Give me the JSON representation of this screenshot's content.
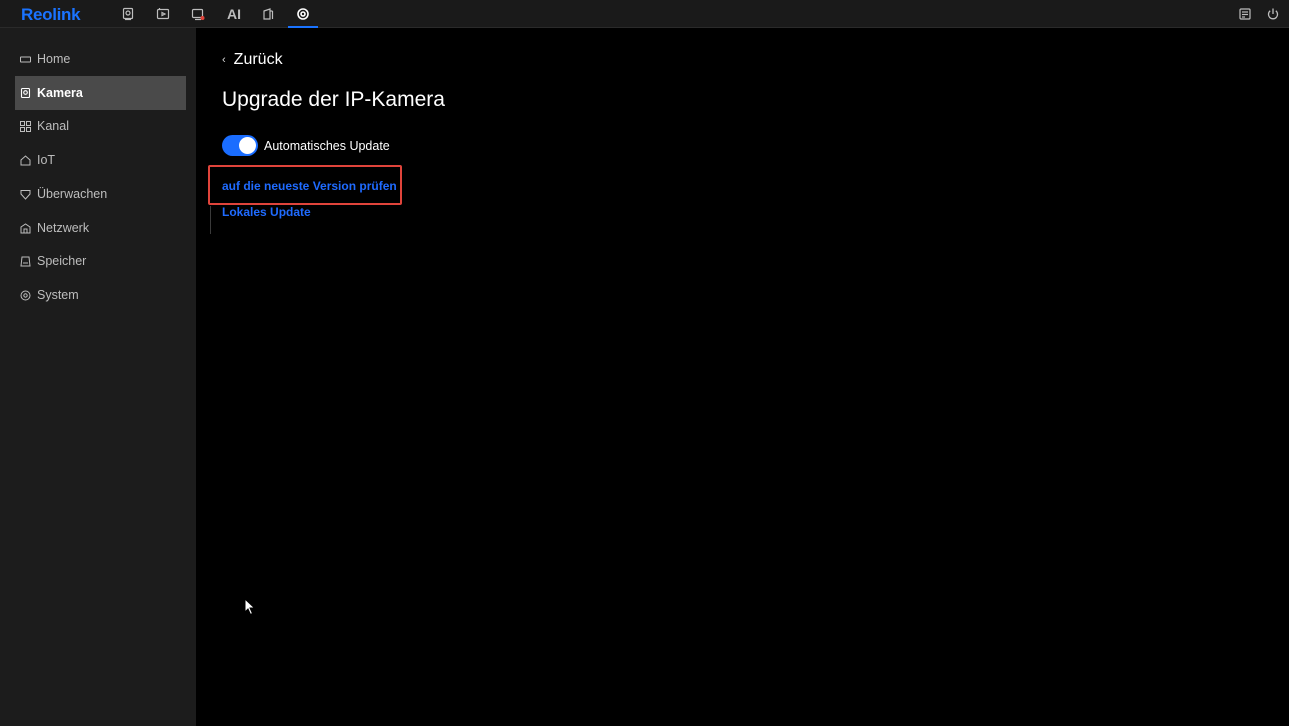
{
  "app": {
    "logo": "Reolink"
  },
  "topbar": {
    "icons": [
      {
        "name": "camera-live-icon"
      },
      {
        "name": "playback-icon"
      },
      {
        "name": "alarm-video-icon"
      },
      {
        "name": "ai-icon",
        "label": "AI"
      },
      {
        "name": "device-icon"
      },
      {
        "name": "settings-icon",
        "active": true
      }
    ],
    "right_icons": [
      "notes-icon",
      "power-icon"
    ]
  },
  "sidebar": {
    "items": [
      {
        "label": "Home",
        "icon": "home-icon"
      },
      {
        "label": "Kamera",
        "icon": "camera-icon",
        "active": true
      },
      {
        "label": "Kanal",
        "icon": "channel-icon"
      },
      {
        "label": "IoT",
        "icon": "iot-icon"
      },
      {
        "label": "Überwachen",
        "icon": "shield-icon"
      },
      {
        "label": "Netzwerk",
        "icon": "network-icon"
      },
      {
        "label": "Speicher",
        "icon": "storage-icon"
      },
      {
        "label": "System",
        "icon": "system-icon"
      }
    ]
  },
  "main": {
    "back_label": "Zurück",
    "title": "Upgrade der IP-Kamera",
    "auto_update": {
      "label": "Automatisches Update",
      "enabled": true
    },
    "check_version_label": "auf die neueste Version prüfen",
    "local_update_label": "Lokales Update"
  },
  "colors": {
    "accent": "#1a73ff",
    "highlight": "#e0443b",
    "sidebar_active": "#4a4a4a"
  }
}
